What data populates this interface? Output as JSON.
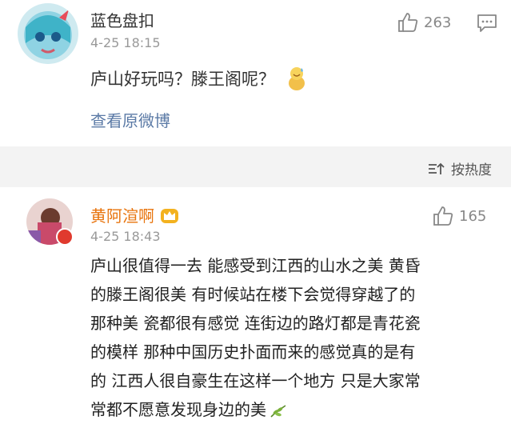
{
  "comment1": {
    "username": "蓝色盘扣",
    "timestamp": "4-25 18:15",
    "like_count": "263",
    "text": "庐山好玩吗？滕王阁呢？",
    "emoji": "sweat-smile-emoji",
    "view_original": "查看原微博"
  },
  "sort": {
    "label": "按热度"
  },
  "comment2": {
    "username": "黄阿渲啊",
    "timestamp": "4-25 18:43",
    "like_count": "165",
    "lines": [
      "庐山很值得一去 能感受到江西的山水之美 黄昏",
      "的滕王阁很美 有时候站在楼下会觉得穿越了的",
      "那种美 瓷都很有感觉 连街边的路灯都是青花瓷",
      "的模样 那种中国历史扑面而来的感觉真的是有",
      "的 江西人很自豪生在这样一个地方 只是大家常",
      "常都不愿意发现身边的美"
    ],
    "emoji": "leaf-emoji"
  },
  "colors": {
    "username_vip": "#e8730b",
    "link": "#5b7aa6",
    "muted": "#999999",
    "band": "#f3f3f3"
  }
}
